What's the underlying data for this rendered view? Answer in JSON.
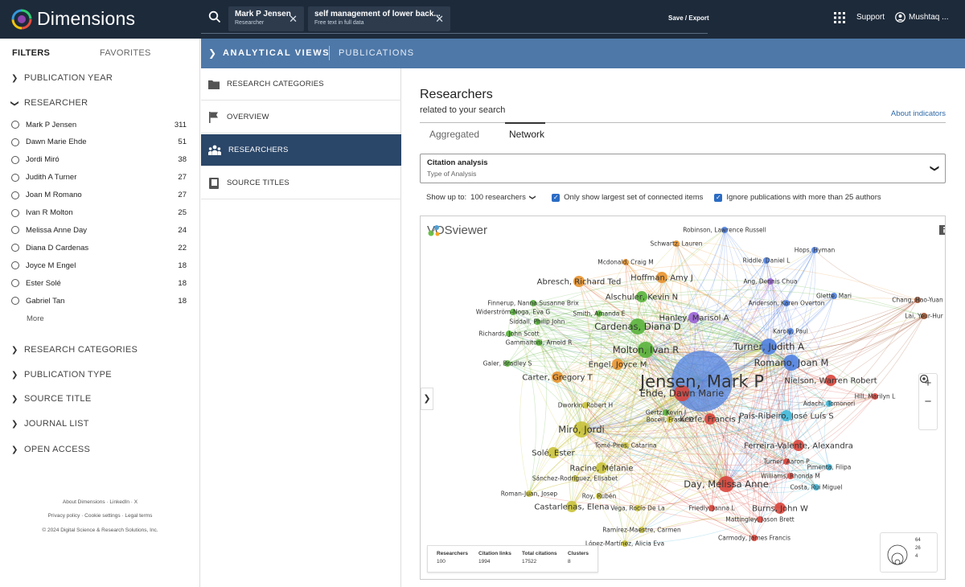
{
  "app": {
    "name": "Dimensions"
  },
  "search": {
    "chips": [
      {
        "title": "Mark P Jensen",
        "subtitle": "Researcher"
      },
      {
        "title": "self management of lower back...",
        "subtitle": "Free text in full data"
      }
    ],
    "save_export": "Save / Export"
  },
  "header": {
    "support": "Support",
    "user": "Mushtaq ..."
  },
  "filters": {
    "tab_filters": "FILTERS",
    "tab_favorites": "FAVORITES",
    "publication_year": "PUBLICATION YEAR",
    "researcher": "RESEARCHER",
    "researchers": [
      {
        "name": "Mark P Jensen",
        "count": "311"
      },
      {
        "name": "Dawn Marie Ehde",
        "count": "51"
      },
      {
        "name": "Jordi Miró",
        "count": "38"
      },
      {
        "name": "Judith A Turner",
        "count": "27"
      },
      {
        "name": "Joan M Romano",
        "count": "27"
      },
      {
        "name": "Ivan R Molton",
        "count": "25"
      },
      {
        "name": "Melissa Anne Day",
        "count": "24"
      },
      {
        "name": "Diana D Cardenas",
        "count": "22"
      },
      {
        "name": "Joyce M Engel",
        "count": "18"
      },
      {
        "name": "Ester Solé",
        "count": "18"
      },
      {
        "name": "Gabriel Tan",
        "count": "18"
      }
    ],
    "more": "More",
    "sections": [
      "RESEARCH CATEGORIES",
      "PUBLICATION TYPE",
      "SOURCE TITLE",
      "JOURNAL LIST",
      "OPEN ACCESS"
    ]
  },
  "footer": {
    "line1": "About Dimensions · LinkedIn · X",
    "line2": "Privacy policy · Cookie settings · Legal terms",
    "line3": "© 2024 Digital Science & Research Solutions, Inc."
  },
  "analytical": {
    "title": "ANALYTICAL VIEWS",
    "publications": "PUBLICATIONS"
  },
  "nav": {
    "items": [
      {
        "label": "RESEARCH CATEGORIES",
        "icon": "folder-icon"
      },
      {
        "label": "OVERVIEW",
        "icon": "flag-icon"
      },
      {
        "label": "RESEARCHERS",
        "icon": "people-icon",
        "active": true
      },
      {
        "label": "SOURCE TITLES",
        "icon": "book-icon"
      }
    ]
  },
  "main": {
    "title": "Researchers",
    "subtitle": "related to your search",
    "about_indicators": "About indicators",
    "tabs": [
      "Aggregated",
      "Network"
    ],
    "active_tab": "Network",
    "analysis_label": "Citation analysis",
    "analysis_sub": "Type of Analysis",
    "show_up_to": "Show up to:",
    "show_value": "100 researchers",
    "opt_connected": "Only show largest set of connected items",
    "opt_ignore": "Ignore publications with more than 25 authors"
  },
  "network": {
    "logo": "VOSviewer",
    "stats": [
      {
        "label": "Researchers",
        "value": "100"
      },
      {
        "label": "Citation links",
        "value": "1994"
      },
      {
        "label": "Total citations",
        "value": "17522"
      },
      {
        "label": "Clusters",
        "value": "8"
      }
    ],
    "legend_values": [
      "64",
      "26",
      "4"
    ],
    "colors": {
      "blue": "#4f81e0",
      "red": "#d9453b",
      "green": "#58b23a",
      "yellow": "#c9c23a",
      "orange": "#e8922e",
      "purple": "#9a62d6",
      "cyan": "#3fb7d8",
      "brown": "#a0522d"
    },
    "nodes": [
      {
        "label": "Jensen, Mark P",
        "c": "blue",
        "s": 5
      },
      {
        "label": "Ehde, Dawn Marie",
        "c": "red",
        "s": 3
      },
      {
        "label": "Miró, Jordi",
        "c": "yellow",
        "s": 3
      },
      {
        "label": "Turner, Judith A",
        "c": "blue",
        "s": 3
      },
      {
        "label": "Romano, Joan M",
        "c": "blue",
        "s": 3
      },
      {
        "label": "Molton, Ivan R",
        "c": "green",
        "s": 3
      },
      {
        "label": "Day, Melissa Anne",
        "c": "red",
        "s": 3
      },
      {
        "label": "Cardenas, Diana D",
        "c": "green",
        "s": 3
      },
      {
        "label": "Engel, Joyce M",
        "c": "orange",
        "s": 2
      },
      {
        "label": "Solé, Ester",
        "c": "yellow",
        "s": 2
      },
      {
        "label": "Hoffman, Amy J",
        "c": "orange",
        "s": 2
      },
      {
        "label": "Abresch, Richard Ted",
        "c": "orange",
        "s": 2
      },
      {
        "label": "Carter, Gregory T",
        "c": "orange",
        "s": 2
      },
      {
        "label": "Hanley, Marisol A",
        "c": "purple",
        "s": 2
      },
      {
        "label": "Alschuler, Kevin N",
        "c": "green",
        "s": 2
      },
      {
        "label": "Keefe, Francis J",
        "c": "red",
        "s": 2
      },
      {
        "label": "Pais-Ribeiro, José Luís S",
        "c": "cyan",
        "s": 2
      },
      {
        "label": "Ferreira-Valente, Alexandra",
        "c": "red",
        "s": 2
      },
      {
        "label": "Nielson, Warren Robert",
        "c": "red",
        "s": 2
      },
      {
        "label": "Racine, Mélanie",
        "c": "yellow",
        "s": 2
      },
      {
        "label": "Sánchez-Rodríguez, Elisabet",
        "c": "yellow",
        "s": 1
      },
      {
        "label": "Castarlenas, Elena",
        "c": "yellow",
        "s": 2
      },
      {
        "label": "Burns, John W",
        "c": "red",
        "s": 2
      },
      {
        "label": "Robinson, Lawrence Russell",
        "c": "blue",
        "s": 1
      },
      {
        "label": "Schwartz, Lauren",
        "c": "orange",
        "s": 1
      },
      {
        "label": "Hops, Hyman",
        "c": "blue",
        "s": 1
      },
      {
        "label": "Riddle, Daniel L",
        "c": "blue",
        "s": 1
      },
      {
        "label": "Mcdonald, Craig M",
        "c": "orange",
        "s": 1
      },
      {
        "label": "Ang, Dennis Chua",
        "c": "purple",
        "s": 1
      },
      {
        "label": "Glette, Mari",
        "c": "blue",
        "s": 1
      },
      {
        "label": "Finnerup, Nanna Susanne Brix",
        "c": "green",
        "s": 1
      },
      {
        "label": "Widerström-Noga, Eva G",
        "c": "green",
        "s": 1
      },
      {
        "label": "Smith, Amanda E",
        "c": "green",
        "s": 1
      },
      {
        "label": "Anderson, Karen Overton",
        "c": "blue",
        "s": 1
      },
      {
        "label": "Chang, Hao-Yuan",
        "c": "brown",
        "s": 1
      },
      {
        "label": "Siddall, Philip John",
        "c": "green",
        "s": 1
      },
      {
        "label": "Lai, Yeur-Hur",
        "c": "brown",
        "s": 1
      },
      {
        "label": "Karoly, Paul",
        "c": "blue",
        "s": 1
      },
      {
        "label": "Richards, John Scott",
        "c": "green",
        "s": 1
      },
      {
        "label": "Gammaitoni, Arnold R",
        "c": "green",
        "s": 1
      },
      {
        "label": "Galer, Bradley S",
        "c": "green",
        "s": 1
      },
      {
        "label": "Hill, Marilyn L",
        "c": "red",
        "s": 1
      },
      {
        "label": "Dworkin, Robert H",
        "c": "yellow",
        "s": 1
      },
      {
        "label": "Adachi, Tomonori",
        "c": "cyan",
        "s": 1
      },
      {
        "label": "Gertz, Kevin J",
        "c": "green",
        "s": 1
      },
      {
        "label": "Bocell, Fraser D",
        "c": "yellow",
        "s": 1
      },
      {
        "label": "Tomé-Pires, Catarina",
        "c": "yellow",
        "s": 1
      },
      {
        "label": "Turner, Aaron P",
        "c": "red",
        "s": 1
      },
      {
        "label": "Pimenta, Filipa",
        "c": "cyan",
        "s": 1
      },
      {
        "label": "Williams, Rhonda M",
        "c": "red",
        "s": 1
      },
      {
        "label": "Costa, Rui Miguel",
        "c": "cyan",
        "s": 1
      },
      {
        "label": "Roman-Juan, Josep",
        "c": "yellow",
        "s": 1
      },
      {
        "label": "Roy, Rubén",
        "c": "yellow",
        "s": 1
      },
      {
        "label": "Vega, Rocío De La",
        "c": "yellow",
        "s": 1
      },
      {
        "label": "Friedly, Janna L",
        "c": "red",
        "s": 1
      },
      {
        "label": "Mattingley, Jason Brett",
        "c": "red",
        "s": 1
      },
      {
        "label": "Ramírez-Maestre, Carmen",
        "c": "yellow",
        "s": 1
      },
      {
        "label": "Carmody, James Francis",
        "c": "red",
        "s": 1
      },
      {
        "label": "López-Martínez, Alicia Eva",
        "c": "yellow",
        "s": 1
      }
    ]
  }
}
